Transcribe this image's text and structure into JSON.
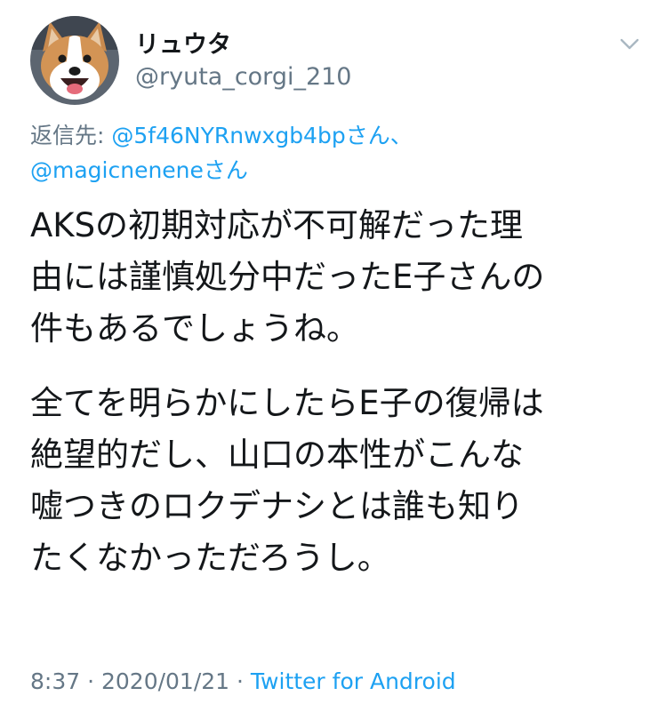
{
  "user": {
    "display_name": "リュウタ",
    "handle": "@ryuta_corgi_210"
  },
  "icons": {
    "avatar": "corgi-avatar",
    "menu": "chevron-down-icon"
  },
  "reply": {
    "label": "返信先: ",
    "mention_1": "@5f46NYRnwxgb4bp",
    "mention_1_suffix": "さん、",
    "mention_2": "@magicnenene",
    "mention_2_suffix": "さん"
  },
  "body": {
    "para1": [
      "AKSの初期対応が不可解だった理",
      "由には謹慎処分中だったE子さんの",
      "件もあるでしょうね。"
    ],
    "para2": [
      "全てを明らかにしたらE子の復帰は",
      "絶望的だし、山口の本性がこんな",
      "嘘つきのロクデナシとは誰も知り",
      "たくなかっただろうし。"
    ]
  },
  "meta": {
    "time": "8:37",
    "sep1": " · ",
    "date": "2020/01/21",
    "sep2": " · ",
    "source": "Twitter for Android"
  },
  "colors": {
    "text": "#14171a",
    "secondary": "#657786",
    "link": "#1da1f2"
  }
}
